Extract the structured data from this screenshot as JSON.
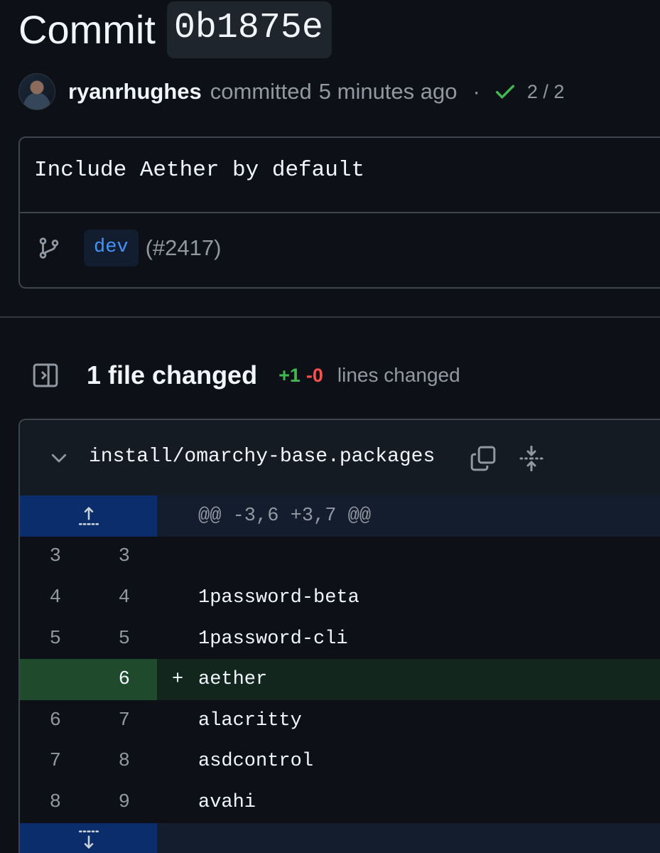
{
  "header": {
    "title_prefix": "Commit",
    "sha": "0b1875e"
  },
  "meta": {
    "author": "ryanrhughes",
    "action": "committed",
    "time": "5 minutes ago",
    "separator": "·",
    "checks": "2 / 2",
    "check_color": "#3fb950"
  },
  "commit": {
    "message": "Include Aether by default",
    "branch": "dev",
    "pr_ref": "(#2417)"
  },
  "files": {
    "summary": "1 file changed",
    "additions": "+1",
    "deletions": "-0",
    "lines_label": "lines changed"
  },
  "diff": {
    "file_path": "install/omarchy-base.packages",
    "hunk_header": "@@ -3,6 +3,7 @@",
    "rows": [
      {
        "old": "3",
        "new": "3",
        "marker": "",
        "code": ""
      },
      {
        "old": "4",
        "new": "4",
        "marker": "",
        "code": "1password-beta"
      },
      {
        "old": "5",
        "new": "5",
        "marker": "",
        "code": "1password-cli"
      },
      {
        "old": "",
        "new": "6",
        "marker": "+",
        "code": "aether"
      },
      {
        "old": "6",
        "new": "7",
        "marker": "",
        "code": "alacritty"
      },
      {
        "old": "7",
        "new": "8",
        "marker": "",
        "code": "asdcontrol"
      },
      {
        "old": "8",
        "new": "9",
        "marker": "",
        "code": "avahi"
      }
    ]
  },
  "icons": {
    "check": "check-icon",
    "branch": "git-branch-icon",
    "sidebar": "sidebar-expand-icon",
    "chevron": "chevron-down-icon",
    "copy": "copy-icon",
    "expand": "unfold-icon",
    "expand_up": "expand-up-icon",
    "expand_down": "expand-down-icon"
  },
  "colors": {
    "background": "#0d1117",
    "addition": "#3fb950",
    "deletion": "#f85149",
    "link": "#4493f8",
    "hunk_gutter": "#0c2d6b",
    "added_gutter": "#1f4a2c"
  }
}
